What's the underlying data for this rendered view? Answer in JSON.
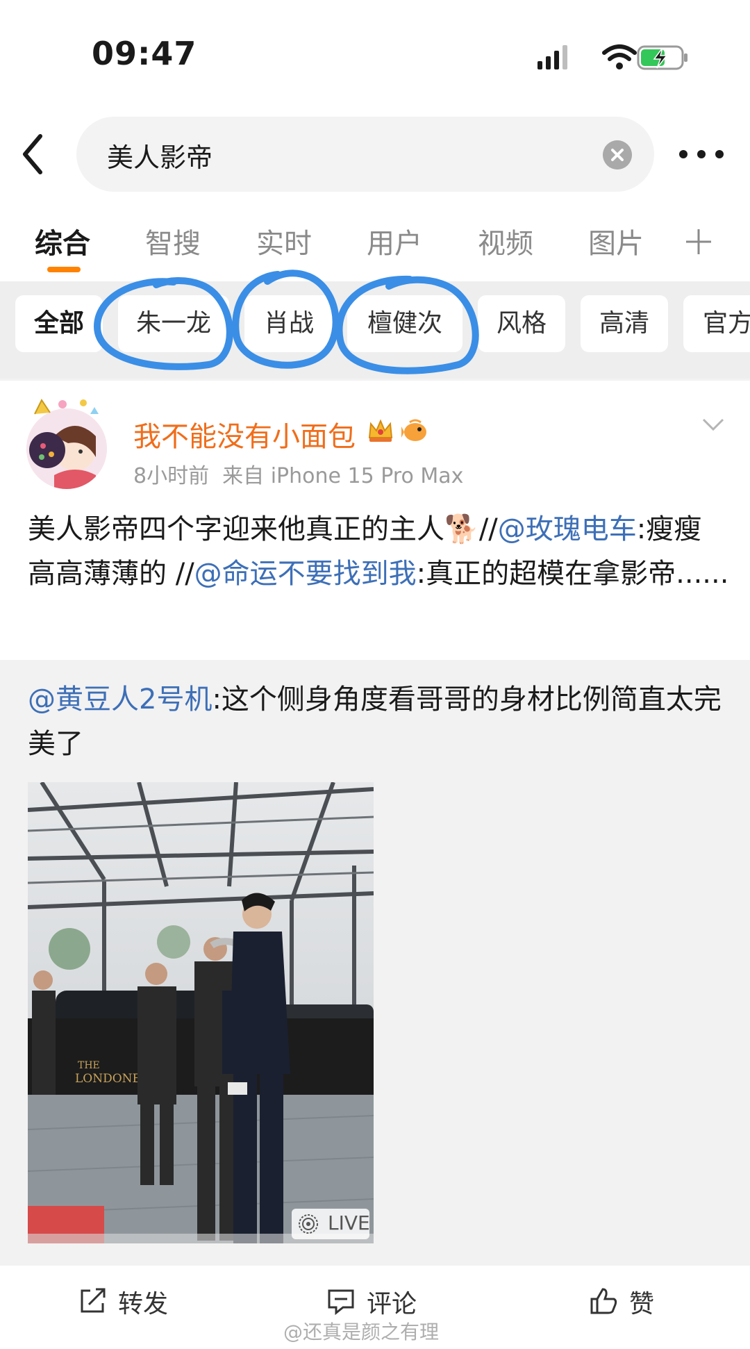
{
  "status_bar": {
    "time": "09:47"
  },
  "search": {
    "query": "美人影帝"
  },
  "tabs": [
    {
      "label": "综合",
      "active": true
    },
    {
      "label": "智搜"
    },
    {
      "label": "实时"
    },
    {
      "label": "用户"
    },
    {
      "label": "视频"
    },
    {
      "label": "图片"
    }
  ],
  "filter_chips": [
    {
      "label": "全部",
      "active": true
    },
    {
      "label": "朱一龙"
    },
    {
      "label": "肖战"
    },
    {
      "label": "檀健次"
    },
    {
      "label": "风格"
    },
    {
      "label": "高清"
    },
    {
      "label": "官方"
    }
  ],
  "post": {
    "username": "我不能没有小面包",
    "time": "8小时前",
    "source": "来自 iPhone 15 Pro Max",
    "text_parts": {
      "p1": "美人影帝四个字迎来他真正的主人",
      "dog": "🐕",
      "sep1": "//",
      "mention1": "@玫瑰电车",
      "p2": ":瘦瘦高高薄薄的 //",
      "mention2": "@命运不要找到我",
      "p3": ":真正的超模在拿影帝......"
    },
    "repost": {
      "mention": "@黄豆人2号机",
      "text": ":这个侧身角度看哥哥的身材比例简直太完美了"
    },
    "image": {
      "live_label": "LIVE",
      "signage": "THE LONDONER"
    }
  },
  "actions": {
    "repost": "转发",
    "comment": "评论",
    "like": "赞"
  },
  "watermark": "@还真是颜之有理",
  "colors": {
    "accent": "#ff8200",
    "username": "#f06d1a",
    "link": "#3d6fb7",
    "scribble": "#3a8ee6"
  }
}
